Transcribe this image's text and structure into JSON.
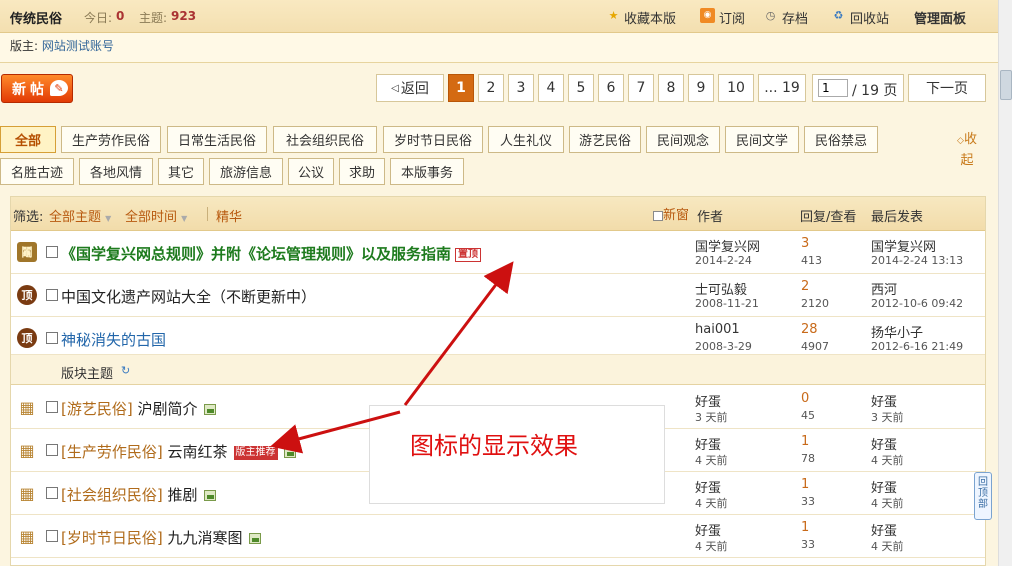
{
  "header": {
    "forum_name": "传统民俗",
    "today_label": "今日:",
    "today_value": "0",
    "topics_label": "主题:",
    "topics_value": "923",
    "links": {
      "favorite": "收藏本版",
      "subscribe": "订阅",
      "archive": "存档",
      "recycle": "回收站",
      "admin": "管理面板"
    }
  },
  "moderator": {
    "label": "版主:",
    "name": "网站测试账号"
  },
  "new_post_label": "新帖",
  "pagination": {
    "back": "返回",
    "pages": [
      "1",
      "2",
      "3",
      "4",
      "5",
      "6",
      "7",
      "8",
      "9",
      "10"
    ],
    "last": "... 19",
    "input_value": "1",
    "total": "/ 19 页",
    "next": "下一页"
  },
  "categories": {
    "row1": [
      "全部",
      "生产劳作民俗",
      "日常生活民俗",
      "社会组织民俗",
      "岁时节日民俗",
      "人生礼仪",
      "游艺民俗",
      "民间观念",
      "民间文学",
      "民俗禁忌"
    ],
    "row2": [
      "名胜古迹",
      "各地风情",
      "其它",
      "旅游信息",
      "公议",
      "求助",
      "本版事务"
    ],
    "collapse": "收起"
  },
  "list_header": {
    "filter_label": "筛选:",
    "all_topics": "全部主题",
    "all_time": "全部时间",
    "digest": "精华",
    "new_window": "新窗",
    "author": "作者",
    "reply_view": "回复/查看",
    "last_post": "最后发表"
  },
  "sticky_rows": [
    {
      "icon": "鬮",
      "title": "《国学复兴网总规则》并附《论坛管理规则》以及服务指南",
      "badge": "置顶",
      "author": "国学复兴网",
      "date": "2014-2-24",
      "replies": "3",
      "views": "413",
      "last_by": "国学复兴网",
      "last_date": "2014-2-24 13:13"
    },
    {
      "icon": "顶",
      "title": "中国文化遗产网站大全（不断更新中）",
      "author": "士可弘毅",
      "date": "2008-11-21",
      "replies": "2",
      "views": "2120",
      "last_by": "西河",
      "last_date": "2012-10-6 09:42"
    },
    {
      "icon": "顶",
      "title": "神秘消失的古国",
      "author": "hai001",
      "date": "2008-3-29",
      "replies": "28",
      "views": "4907",
      "last_by": "扬华小子",
      "last_date": "2012-6-16 21:49"
    }
  ],
  "section": {
    "label": "版块主题"
  },
  "normal_rows": [
    {
      "type": "[游艺民俗]",
      "title": "沪剧简介",
      "author": "好蛋",
      "date": "3 天前",
      "replies": "0",
      "views": "45",
      "last_by": "好蛋",
      "last_date": "3 天前"
    },
    {
      "type": "[生产劳作民俗]",
      "title": "云南红茶",
      "badge": "版主推荐",
      "author": "好蛋",
      "date": "4 天前",
      "replies": "1",
      "views": "78",
      "last_by": "好蛋",
      "last_date": "4 天前"
    },
    {
      "type": "[社会组织民俗]",
      "title": "推剧",
      "author": "好蛋",
      "date": "4 天前",
      "replies": "1",
      "views": "33",
      "last_by": "好蛋",
      "last_date": "4 天前"
    },
    {
      "type": "[岁时节日民俗]",
      "title": "九九消寒图",
      "author": "好蛋",
      "date": "4 天前",
      "replies": "1",
      "views": "33",
      "last_by": "好蛋",
      "last_date": "4 天前"
    }
  ],
  "annotation": "图标的显示效果",
  "back_to_top": "回顶部",
  "colors": {
    "accent": "#d46a12",
    "annotation_red": "#e01010",
    "sticky_green": "#1e7b1e"
  }
}
